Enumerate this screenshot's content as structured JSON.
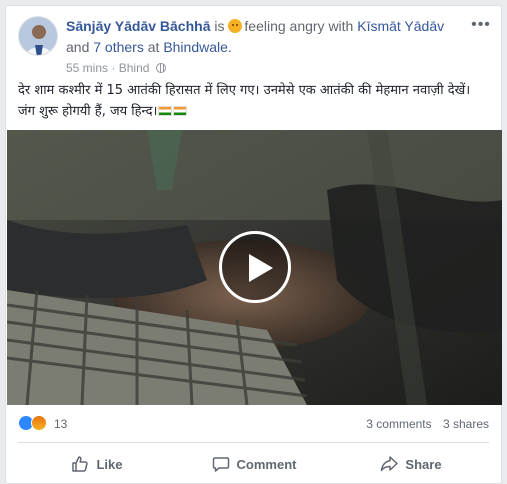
{
  "post": {
    "author": "Sānjāy Yādāv Bāchhā",
    "is_text": "is",
    "feeling": "feeling angry with",
    "tagged": "Kīsmāt Yādāv",
    "and_text": "and",
    "others": "7 others",
    "at_text": "at",
    "place": "Bhindwale.",
    "time": "55 mins",
    "location": "Bhind",
    "text": "देर शाम कश्मीर में 15 आतंकी हिरासत में लिए गए। उनमेसे एक आतंकी की मेहमान नवाज़ी देखें। जंग शुरू होगयी हैं, जय हिन्द।"
  },
  "stats": {
    "reaction_count": "13",
    "comments": "3 comments",
    "shares": "3 shares"
  },
  "actions": {
    "like": "Like",
    "comment": "Comment",
    "share": "Share"
  },
  "colors": {
    "link": "#365899",
    "like_blue": "#2d88ff",
    "angry_orange": "#e9710f"
  }
}
